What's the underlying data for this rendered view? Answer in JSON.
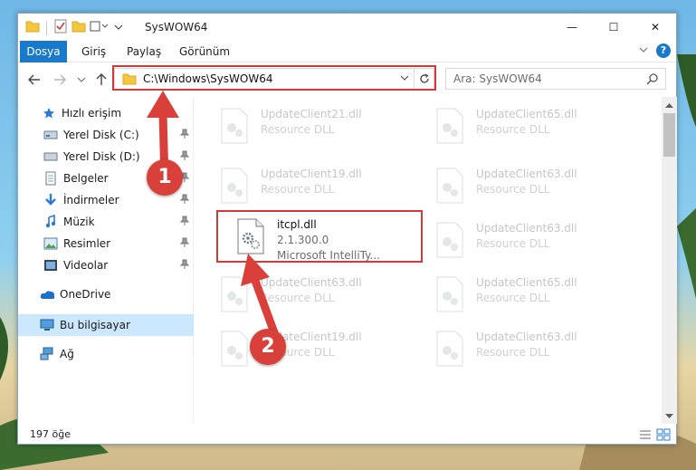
{
  "window": {
    "title": "SysWOW64",
    "controls": {
      "minimize": "—",
      "maximize": "☐",
      "close": "✕"
    }
  },
  "ribbon": {
    "tabs": [
      "Dosya",
      "Giriş",
      "Paylaş",
      "Görünüm"
    ]
  },
  "address": {
    "path": "C:\\Windows\\SysWOW64",
    "search_placeholder": "Ara: SysWOW64"
  },
  "nav_pane": {
    "items": [
      {
        "label": "Hızlı erişim",
        "icon": "star-icon",
        "pinned": false
      },
      {
        "label": "Yerel Disk (C:)",
        "icon": "drive-icon",
        "pinned": true
      },
      {
        "label": "Yerel Disk (D:)",
        "icon": "drive-icon",
        "pinned": true
      },
      {
        "label": "Belgeler",
        "icon": "documents-icon",
        "pinned": true
      },
      {
        "label": "İndirmeler",
        "icon": "download-icon",
        "pinned": true
      },
      {
        "label": "Müzik",
        "icon": "music-icon",
        "pinned": true
      },
      {
        "label": "Resimler",
        "icon": "pictures-icon",
        "pinned": true
      },
      {
        "label": "Videolar",
        "icon": "videos-icon",
        "pinned": true
      },
      {
        "label": "OneDrive",
        "icon": "cloud-icon",
        "pinned": false
      },
      {
        "label": "Bu bilgisayar",
        "icon": "computer-icon",
        "pinned": false,
        "selected": true
      },
      {
        "label": "Ağ",
        "icon": "network-icon",
        "pinned": false
      }
    ]
  },
  "files": [
    {
      "name": "UpdateClient21.dll",
      "desc": "Resource DLL",
      "faded": true
    },
    {
      "name": "UpdateClient65.dll",
      "desc": "Resource DLL",
      "faded": true
    },
    {
      "name": "UpdateClient19.dll",
      "desc": "Resource DLL",
      "faded": true
    },
    {
      "name": "UpdateClient63.dll",
      "desc": "Resource DLL",
      "faded": true
    },
    {
      "name": "itcpl.dll",
      "desc": "2.1.300.0",
      "desc2": "Microsoft IntelliTy...",
      "faded": false
    },
    {
      "name": "UpdateClient63.dll",
      "desc": "Resource DLL",
      "faded": true
    },
    {
      "name": "UpdateClient63.dll",
      "desc": "Resource DLL",
      "faded": true
    },
    {
      "name": "UpdateClient65.dll",
      "desc": "Resource DLL",
      "faded": true
    },
    {
      "name": "UpdateClient19.dll",
      "desc": "Resource DLL",
      "faded": true
    },
    {
      "name": "UpdateClient63.dll",
      "desc": "Resource DLL",
      "faded": true
    }
  ],
  "status": {
    "item_count": "197 öğe"
  },
  "markers": [
    "1",
    "2"
  ],
  "colors": {
    "accent": "#1979ca",
    "highlight": "#d23a3a",
    "marker": "#d9403a",
    "selected_nav": "#cce8ff"
  }
}
